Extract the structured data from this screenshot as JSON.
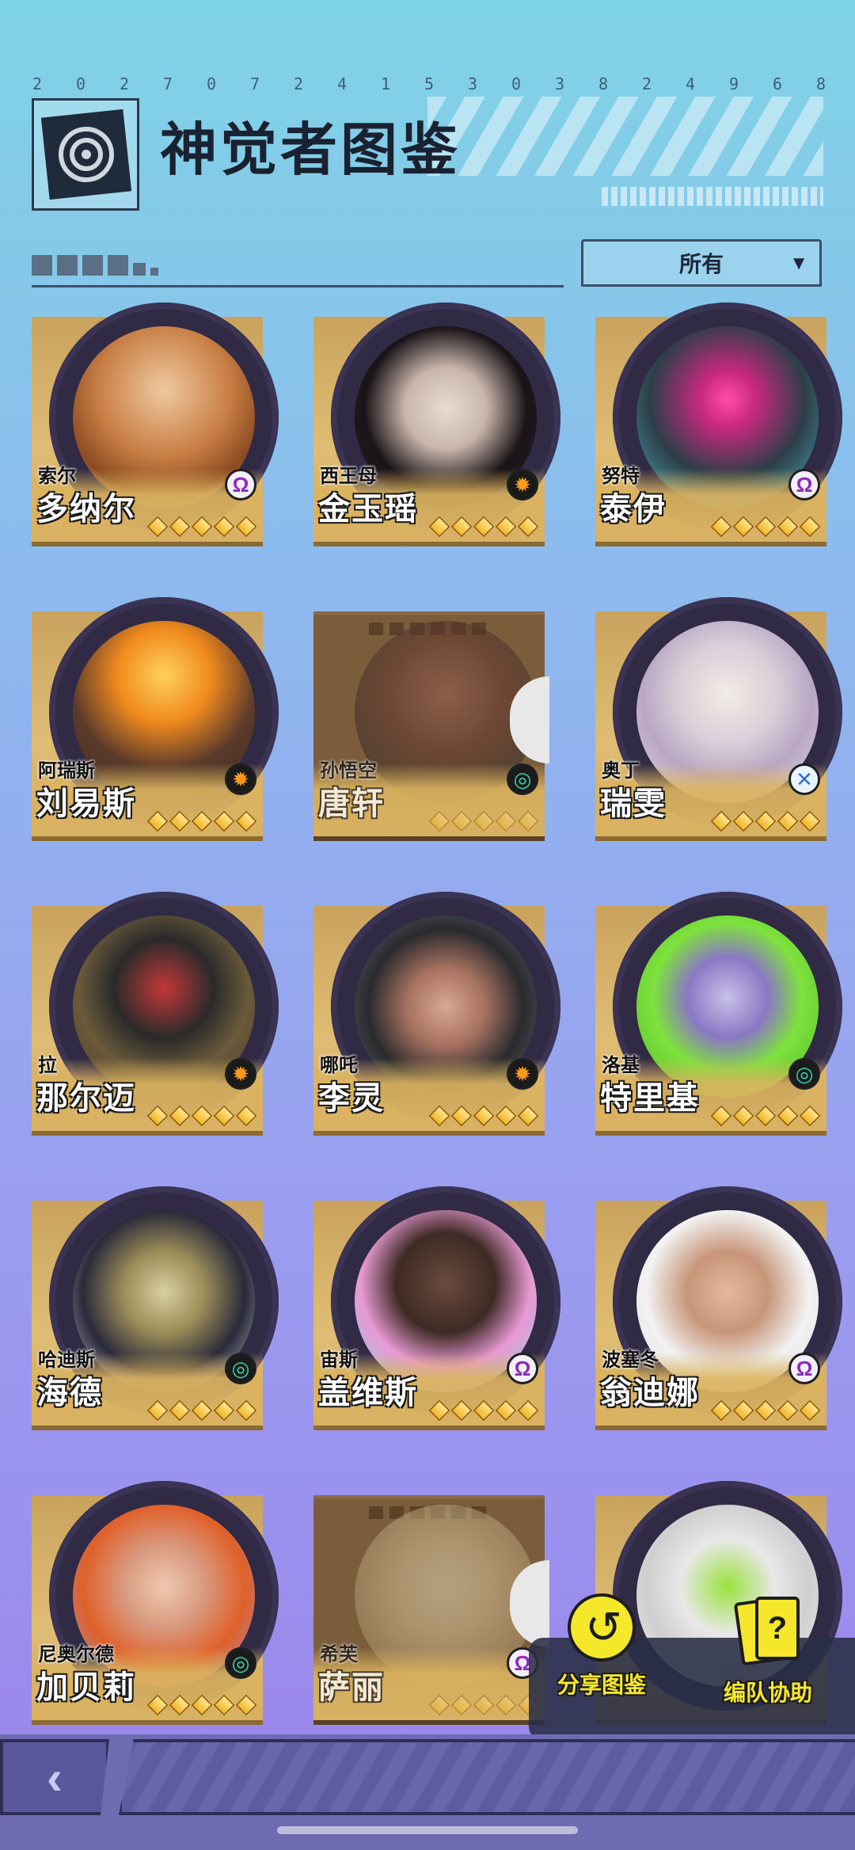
{
  "header": {
    "serial_digits": [
      "2",
      "0",
      "2",
      "7",
      "0",
      "7",
      "2",
      "4",
      "1",
      "5",
      "3",
      "0",
      "3",
      "8",
      "2",
      "4",
      "9",
      "6",
      "8"
    ],
    "title": "神觉者图鉴"
  },
  "filter": {
    "selected": "所有"
  },
  "colors": {
    "card_gold": "#d9b163",
    "ring": "#302a45",
    "accent_yellow": "#f5e72a",
    "background_top": "#7fd4e6",
    "background_bottom": "#9b84ea"
  },
  "characters": [
    {
      "alias": "索尔",
      "name": "多纳尔",
      "element": "psychic-icon",
      "locked": false,
      "stars": 5
    },
    {
      "alias": "西王母",
      "name": "金玉瑶",
      "element": "sun-icon",
      "locked": false,
      "stars": 5
    },
    {
      "alias": "努特",
      "name": "泰伊",
      "element": "psychic-icon",
      "locked": false,
      "stars": 5
    },
    {
      "alias": "阿瑞斯",
      "name": "刘易斯",
      "element": "sun-icon",
      "locked": false,
      "stars": 5
    },
    {
      "alias": "孙悟空",
      "name": "唐轩",
      "element": "wind-icon",
      "locked": true,
      "stars": 5
    },
    {
      "alias": "奥丁",
      "name": "瑞雯",
      "element": "cross-icon",
      "locked": false,
      "stars": 5
    },
    {
      "alias": "拉",
      "name": "那尔迈",
      "element": "sun-icon",
      "locked": false,
      "stars": 5
    },
    {
      "alias": "哪吒",
      "name": "李灵",
      "element": "sun-icon",
      "locked": false,
      "stars": 5
    },
    {
      "alias": "洛基",
      "name": "特里基",
      "element": "wind-icon",
      "locked": false,
      "stars": 5
    },
    {
      "alias": "哈迪斯",
      "name": "海德",
      "element": "wind-icon",
      "locked": false,
      "stars": 5
    },
    {
      "alias": "宙斯",
      "name": "盖维斯",
      "element": "psychic-icon",
      "locked": false,
      "stars": 5
    },
    {
      "alias": "波塞冬",
      "name": "翁迪娜",
      "element": "psychic-icon",
      "locked": false,
      "stars": 5
    },
    {
      "alias": "尼奥尔德",
      "name": "加贝莉",
      "element": "wind-icon",
      "locked": false,
      "stars": 5
    },
    {
      "alias": "希芙",
      "name": "萨丽",
      "element": "psychic-icon",
      "locked": true,
      "stars": 5
    },
    {
      "alias": "",
      "name": "",
      "element": "",
      "locked": false,
      "stars": 0
    }
  ],
  "actions": {
    "share_label": "分享图鉴",
    "team_label": "编队协助",
    "team_icon_glyph": "?"
  },
  "nav": {
    "back_glyph": "‹"
  }
}
